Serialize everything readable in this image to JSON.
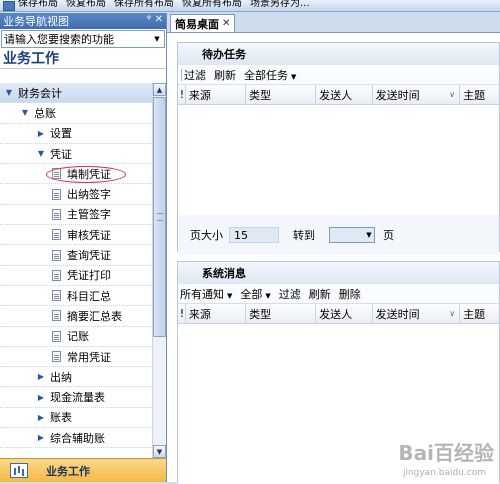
{
  "toolbar": {
    "items": [
      "保存布局",
      "恢复布局",
      "保存所有布局",
      "恢复所有布局",
      "场景另存为..."
    ]
  },
  "nav": {
    "title": "业务导航视图",
    "pin": "ᵠ",
    "close": "✕",
    "search_placeholder": "请输入您要搜索的功能",
    "section_title": "业务工作",
    "tree": [
      {
        "label": "财务会计",
        "level": 0,
        "arrow": "▼"
      },
      {
        "label": "总账",
        "level": 1,
        "arrow": "▼"
      },
      {
        "label": "设置",
        "level": 2,
        "arrow": "▶"
      },
      {
        "label": "凭证",
        "level": 2,
        "arrow": "▼"
      },
      {
        "label": "填制凭证",
        "level": 3
      },
      {
        "label": "出纳签字",
        "level": 3
      },
      {
        "label": "主管签字",
        "level": 3
      },
      {
        "label": "审核凭证",
        "level": 3
      },
      {
        "label": "查询凭证",
        "level": 3
      },
      {
        "label": "凭证打印",
        "level": 3
      },
      {
        "label": "科目汇总",
        "level": 3
      },
      {
        "label": "摘要汇总表",
        "level": 3
      },
      {
        "label": "记账",
        "level": 3
      },
      {
        "label": "常用凭证",
        "level": 3
      },
      {
        "label": "出纳",
        "level": 2,
        "arrow": "▶"
      },
      {
        "label": "现金流量表",
        "level": 2,
        "arrow": "▶"
      },
      {
        "label": "账表",
        "level": 2,
        "arrow": "▶"
      },
      {
        "label": "综合辅助账",
        "level": 2,
        "arrow": "▶"
      }
    ],
    "bottom_label": "业务工作"
  },
  "tabs": [
    {
      "label": "简易桌面",
      "close": "✕"
    }
  ],
  "todo": {
    "title": "待办任务",
    "toolbar": [
      "过滤",
      "刷新",
      "全部任务"
    ],
    "columns": [
      "!",
      "来源",
      "类型",
      "发送人",
      "发送时间",
      "主题"
    ],
    "pager": {
      "page_size_label": "页大小",
      "page_size": "15",
      "goto_label": "转到",
      "page_label": "页"
    }
  },
  "messages": {
    "title": "系统消息",
    "toolbar": [
      "所有通知",
      "全部",
      "过滤",
      "刷新",
      "删除"
    ],
    "columns": [
      "!",
      "来源",
      "类型",
      "发送人",
      "发送时间",
      "主题"
    ]
  },
  "watermark": {
    "main": "Bai百经验",
    "sub": "jingyan.baidu.com"
  },
  "colors": {
    "header_blue": "#3e6db0",
    "accent_orange": "#f5b845",
    "highlight_red": "#e0303a"
  }
}
